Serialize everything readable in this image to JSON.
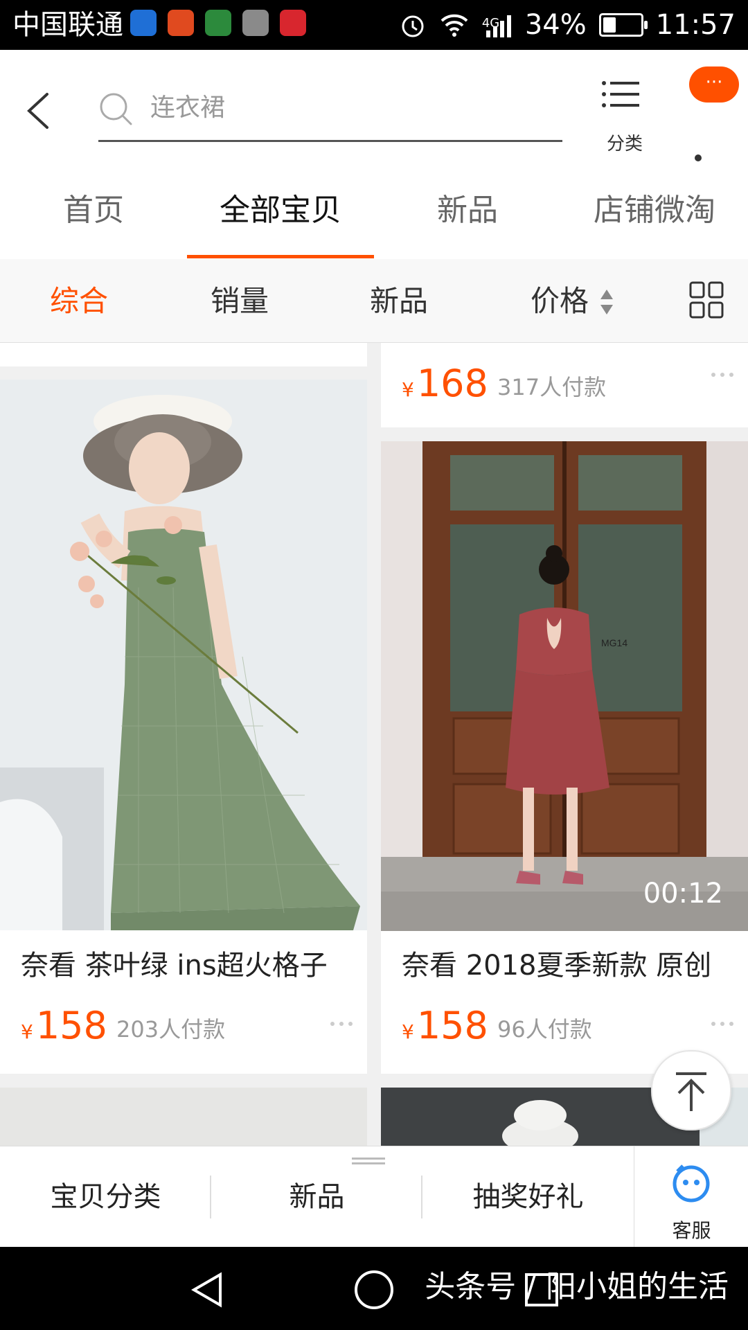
{
  "status_bar": {
    "carrier": "中国联通",
    "network": "4G",
    "battery": "34%",
    "battery_level": 0.34,
    "time": "11:57",
    "icons": [
      "wifi-call-icon",
      "browser-app-icon",
      "novel-app-icon",
      "gallery-icon",
      "sohu-video-icon",
      "alarm-icon",
      "wifi-icon",
      "signal-icon",
      "battery-icon"
    ]
  },
  "header": {
    "search_placeholder": "连衣裙",
    "category_label": "分类",
    "more_badge": "···"
  },
  "shop_tabs": [
    {
      "label": "首页",
      "active": false
    },
    {
      "label": "全部宝贝",
      "active": true
    },
    {
      "label": "新品",
      "active": false
    },
    {
      "label": "店铺微淘",
      "active": false
    }
  ],
  "sort_bar": [
    {
      "label": "综合",
      "active": true
    },
    {
      "label": "销量",
      "active": false
    },
    {
      "label": "新品",
      "active": false
    },
    {
      "label": "价格",
      "active": false
    }
  ],
  "products": [
    {
      "title": "",
      "currency": "¥",
      "price": "168",
      "sold": "317人付款"
    },
    {
      "title": "奈看 茶叶绿 ins超火格子",
      "currency": "¥",
      "price": "158",
      "sold": "203人付款"
    },
    {
      "title": "奈看 2018夏季新款 原创",
      "currency": "¥",
      "price": "158",
      "sold": "96人付款",
      "video_duration": "00:12",
      "door_sign": "MG14"
    }
  ],
  "shop_nav": {
    "items": [
      "宝贝分类",
      "新品",
      "抽奖好礼"
    ],
    "customer_service": "客服"
  },
  "watermark": "头条号 / 阳小姐的生活",
  "colors": {
    "accent": "#ff5000",
    "text": "#222222",
    "muted": "#999999"
  }
}
